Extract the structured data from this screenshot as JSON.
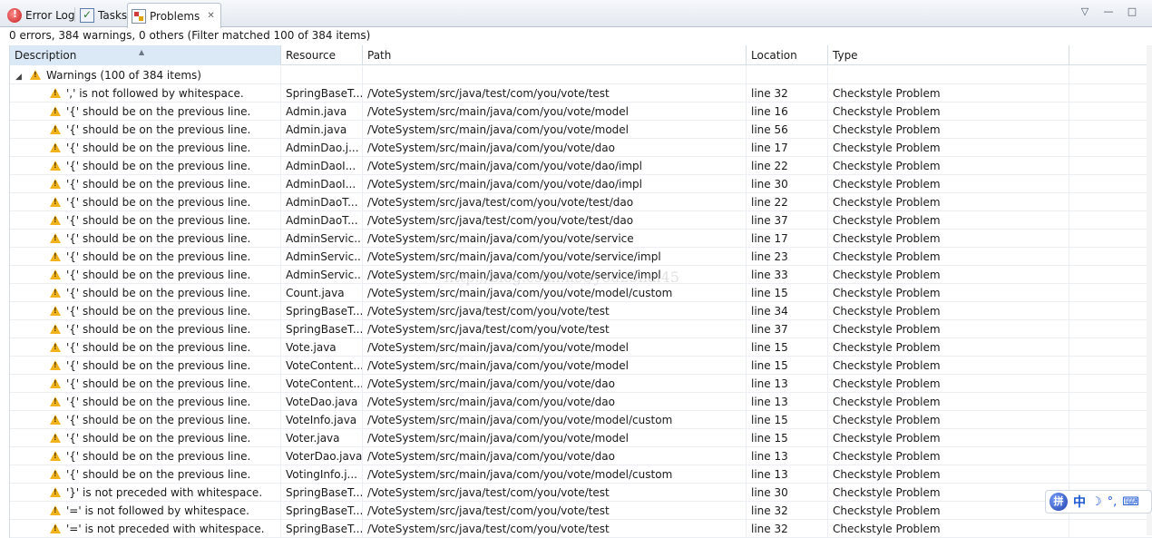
{
  "tabs": [
    {
      "label": "Error Log",
      "icon": "error-log-icon"
    },
    {
      "label": "Tasks",
      "icon": "tasks-icon"
    },
    {
      "label": "Problems",
      "icon": "problems-icon",
      "active": true,
      "close": "✕"
    }
  ],
  "toolbar": {
    "view_menu": "▽",
    "minimize": "—",
    "maximize": "□"
  },
  "summary": "0 errors, 384 warnings, 0 others (Filter matched 100 of 384 items)",
  "columns": {
    "description": "Description",
    "resource": "Resource",
    "path": "Path",
    "location": "Location",
    "type": "Type"
  },
  "group": {
    "label": "Warnings (100 of 384 items)",
    "expanded": true
  },
  "rows": [
    {
      "desc": "',' is not followed by whitespace.",
      "res": "SpringBaseT...",
      "path": "/VoteSystem/src/java/test/com/you/vote/test",
      "loc": "line 32",
      "type": "Checkstyle Problem"
    },
    {
      "desc": "'{' should be on the previous line.",
      "res": "Admin.java",
      "path": "/VoteSystem/src/main/java/com/you/vote/model",
      "loc": "line 16",
      "type": "Checkstyle Problem"
    },
    {
      "desc": "'{' should be on the previous line.",
      "res": "Admin.java",
      "path": "/VoteSystem/src/main/java/com/you/vote/model",
      "loc": "line 56",
      "type": "Checkstyle Problem"
    },
    {
      "desc": "'{' should be on the previous line.",
      "res": "AdminDao.j...",
      "path": "/VoteSystem/src/main/java/com/you/vote/dao",
      "loc": "line 17",
      "type": "Checkstyle Problem"
    },
    {
      "desc": "'{' should be on the previous line.",
      "res": "AdminDaoI...",
      "path": "/VoteSystem/src/main/java/com/you/vote/dao/impl",
      "loc": "line 22",
      "type": "Checkstyle Problem"
    },
    {
      "desc": "'{' should be on the previous line.",
      "res": "AdminDaoI...",
      "path": "/VoteSystem/src/main/java/com/you/vote/dao/impl",
      "loc": "line 30",
      "type": "Checkstyle Problem"
    },
    {
      "desc": "'{' should be on the previous line.",
      "res": "AdminDaoT...",
      "path": "/VoteSystem/src/java/test/com/you/vote/test/dao",
      "loc": "line 22",
      "type": "Checkstyle Problem"
    },
    {
      "desc": "'{' should be on the previous line.",
      "res": "AdminDaoT...",
      "path": "/VoteSystem/src/java/test/com/you/vote/test/dao",
      "loc": "line 37",
      "type": "Checkstyle Problem"
    },
    {
      "desc": "'{' should be on the previous line.",
      "res": "AdminServic...",
      "path": "/VoteSystem/src/main/java/com/you/vote/service",
      "loc": "line 17",
      "type": "Checkstyle Problem"
    },
    {
      "desc": "'{' should be on the previous line.",
      "res": "AdminServic...",
      "path": "/VoteSystem/src/main/java/com/you/vote/service/impl",
      "loc": "line 23",
      "type": "Checkstyle Problem"
    },
    {
      "desc": "'{' should be on the previous line.",
      "res": "AdminServic...",
      "path": "/VoteSystem/src/main/java/com/you/vote/service/impl",
      "loc": "line 33",
      "type": "Checkstyle Problem"
    },
    {
      "desc": "'{' should be on the previous line.",
      "res": "Count.java",
      "path": "/VoteSystem/src/main/java/com/you/vote/model/custom",
      "loc": "line 15",
      "type": "Checkstyle Problem"
    },
    {
      "desc": "'{' should be on the previous line.",
      "res": "SpringBaseT...",
      "path": "/VoteSystem/src/java/test/com/you/vote/test",
      "loc": "line 34",
      "type": "Checkstyle Problem"
    },
    {
      "desc": "'{' should be on the previous line.",
      "res": "SpringBaseT...",
      "path": "/VoteSystem/src/java/test/com/you/vote/test",
      "loc": "line 37",
      "type": "Checkstyle Problem"
    },
    {
      "desc": "'{' should be on the previous line.",
      "res": "Vote.java",
      "path": "/VoteSystem/src/main/java/com/you/vote/model",
      "loc": "line 15",
      "type": "Checkstyle Problem"
    },
    {
      "desc": "'{' should be on the previous line.",
      "res": "VoteContent...",
      "path": "/VoteSystem/src/main/java/com/you/vote/model",
      "loc": "line 15",
      "type": "Checkstyle Problem"
    },
    {
      "desc": "'{' should be on the previous line.",
      "res": "VoteContent...",
      "path": "/VoteSystem/src/main/java/com/you/vote/dao",
      "loc": "line 13",
      "type": "Checkstyle Problem"
    },
    {
      "desc": "'{' should be on the previous line.",
      "res": "VoteDao.java",
      "path": "/VoteSystem/src/main/java/com/you/vote/dao",
      "loc": "line 13",
      "type": "Checkstyle Problem"
    },
    {
      "desc": "'{' should be on the previous line.",
      "res": "VoteInfo.java",
      "path": "/VoteSystem/src/main/java/com/you/vote/model/custom",
      "loc": "line 15",
      "type": "Checkstyle Problem"
    },
    {
      "desc": "'{' should be on the previous line.",
      "res": "Voter.java",
      "path": "/VoteSystem/src/main/java/com/you/vote/model",
      "loc": "line 15",
      "type": "Checkstyle Problem"
    },
    {
      "desc": "'{' should be on the previous line.",
      "res": "VoterDao.java",
      "path": "/VoteSystem/src/main/java/com/you/vote/dao",
      "loc": "line 13",
      "type": "Checkstyle Problem"
    },
    {
      "desc": "'{' should be on the previous line.",
      "res": "VotingInfo.j...",
      "path": "/VoteSystem/src/main/java/com/you/vote/model/custom",
      "loc": "line 13",
      "type": "Checkstyle Problem"
    },
    {
      "desc": "'}' is not preceded with whitespace.",
      "res": "SpringBaseT...",
      "path": "/VoteSystem/src/java/test/com/you/vote/test",
      "loc": "line 30",
      "type": "Checkstyle Problem"
    },
    {
      "desc": "'=' is not followed by whitespace.",
      "res": "SpringBaseT...",
      "path": "/VoteSystem/src/java/test/com/you/vote/test",
      "loc": "line 32",
      "type": "Checkstyle Problem"
    },
    {
      "desc": "'=' is not preceded with whitespace.",
      "res": "SpringBaseT...",
      "path": "/VoteSystem/src/java/test/com/you/vote/test",
      "loc": "line 32",
      "type": "Checkstyle Problem"
    }
  ],
  "watermark": "http://blog.csdn.net/you23hai45",
  "ime": {
    "logo": "拼",
    "mode": "中",
    "moon": "☽",
    "punct": "°,",
    "keyboard": "⌨"
  },
  "colors": {
    "warning": "#f1b21b",
    "sorted_header": "#dbe9f7",
    "tab_bar": "#e4e9f0"
  }
}
